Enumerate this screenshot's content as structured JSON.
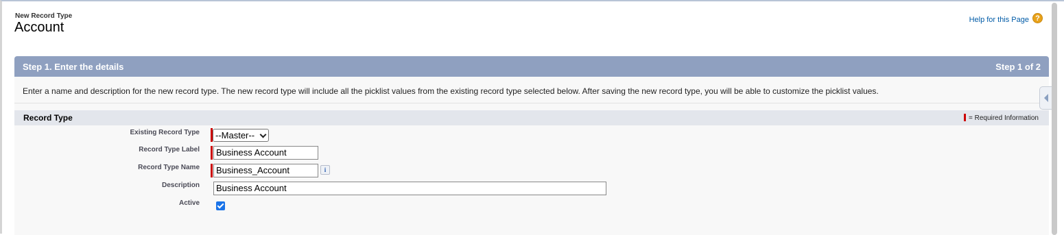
{
  "header": {
    "page_type": "New Record Type",
    "title": "Account",
    "help_link": "Help for this Page",
    "help_icon": "question-mark-icon"
  },
  "step": {
    "title": "Step 1. Enter the details",
    "count": "Step 1 of 2"
  },
  "instructions": "Enter a name and description for the new record type. The new record type will include all the picklist values from the existing record type selected below. After saving the new record type, you will be able to customize the picklist values.",
  "section": {
    "title": "Record Type",
    "required_legend": "= Required Information"
  },
  "fields": {
    "existing_record_type": {
      "label": "Existing Record Type",
      "value": "--Master--"
    },
    "record_type_label": {
      "label": "Record Type Label",
      "value": "Business Account"
    },
    "record_type_name": {
      "label": "Record Type Name",
      "value": "Business_Account"
    },
    "description": {
      "label": "Description",
      "value": "Business Account"
    },
    "active": {
      "label": "Active",
      "checked": true
    }
  },
  "colors": {
    "header_bar": "#8fa0c0",
    "required": "#cc0000",
    "link": "#015ba7",
    "checkbox": "#1a73e8"
  }
}
